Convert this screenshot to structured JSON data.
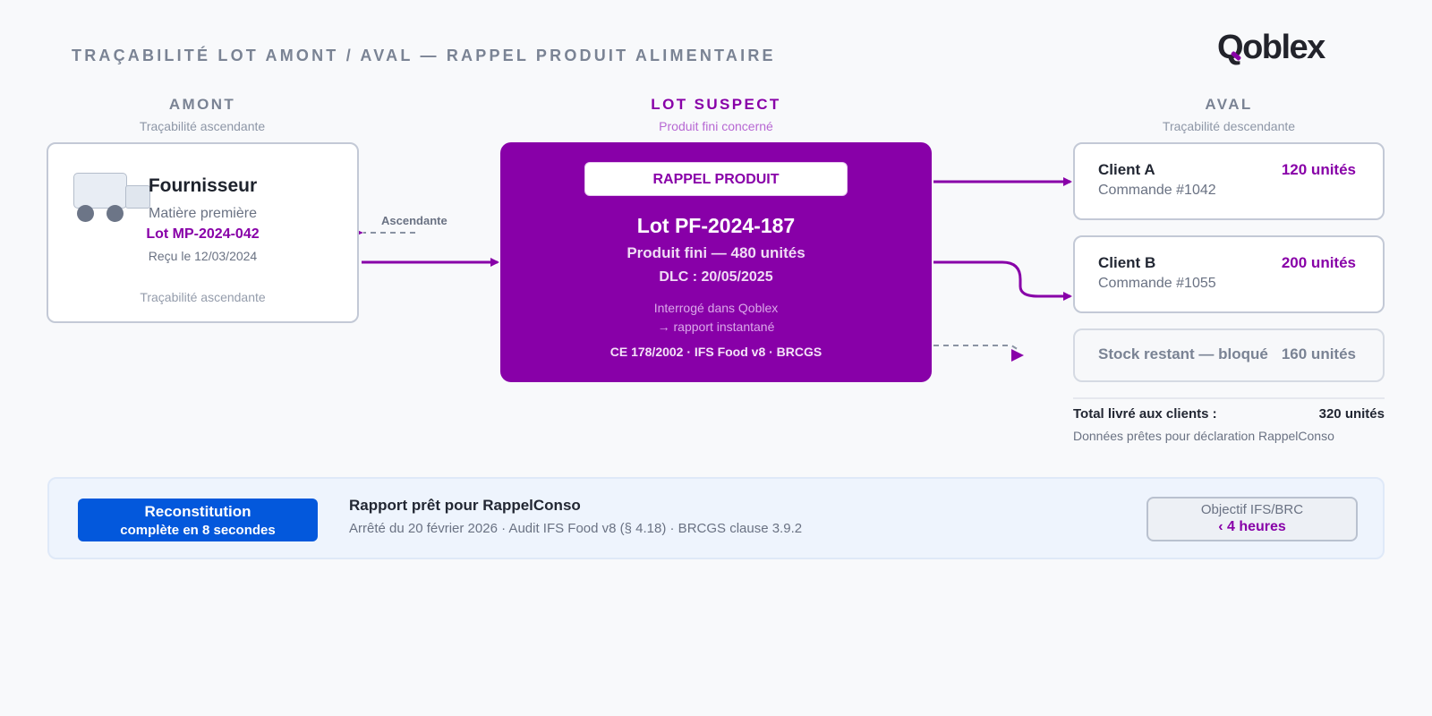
{
  "page_title": "TRAÇABILITÉ LOT AMONT / AVAL — RAPPEL PRODUIT ALIMENTAIRE",
  "logo": {
    "text_q": "Q",
    "text_rest": "oblex"
  },
  "colors": {
    "brand": "#8800a8",
    "blue": "#0358dc",
    "muted": "#7a8394"
  },
  "upstream": {
    "heading": "AMONT",
    "subheading": "Traçabilité ascendante",
    "card": {
      "icon": "truck-icon",
      "title": "Fournisseur",
      "material": "Matière première",
      "lot": "Lot MP-2024-042",
      "received": "Reçu le 12/03/2024",
      "footer": "Traçabilité ascendante"
    },
    "link_label": "Ascendante"
  },
  "suspect": {
    "heading": "LOT SUSPECT",
    "subheading": "Produit fini concerné",
    "badge": "RAPPEL PRODUIT",
    "lot": "Lot PF-2024-187",
    "product": "Produit fini — 480 unités",
    "dlc": "DLC : 20/05/2025",
    "query_line1": "Interrogé dans Qoblex",
    "query_line2": "→ rapport instantané",
    "standards": "CE 178/2002 · IFS Food v8 · BRCGS"
  },
  "downstream": {
    "heading": "AVAL",
    "subheading": "Traçabilité descendante",
    "clients": [
      {
        "name": "Client A",
        "order": "Commande #1042",
        "qty": "120 unités"
      },
      {
        "name": "Client B",
        "order": "Commande #1055",
        "qty": "200 unités"
      }
    ],
    "stock": {
      "label": "Stock restant — bloqué",
      "qty": "160 unités"
    },
    "total_label": "Total livré aux clients :",
    "total_value": "320 unités",
    "total_note": "Données prêtes pour déclaration RappelConso"
  },
  "banner": {
    "button_line1": "Reconstitution",
    "button_line2": "complète en 8 secondes",
    "title": "Rapport prêt pour RappelConso",
    "details": "Arrêté du 20 février 2026 · Audit IFS Food v8 (§ 4.18) · BRCGS clause 3.9.2",
    "objective_line1": "Objectif IFS/BRC",
    "objective_line2": "‹ 4 heures"
  }
}
